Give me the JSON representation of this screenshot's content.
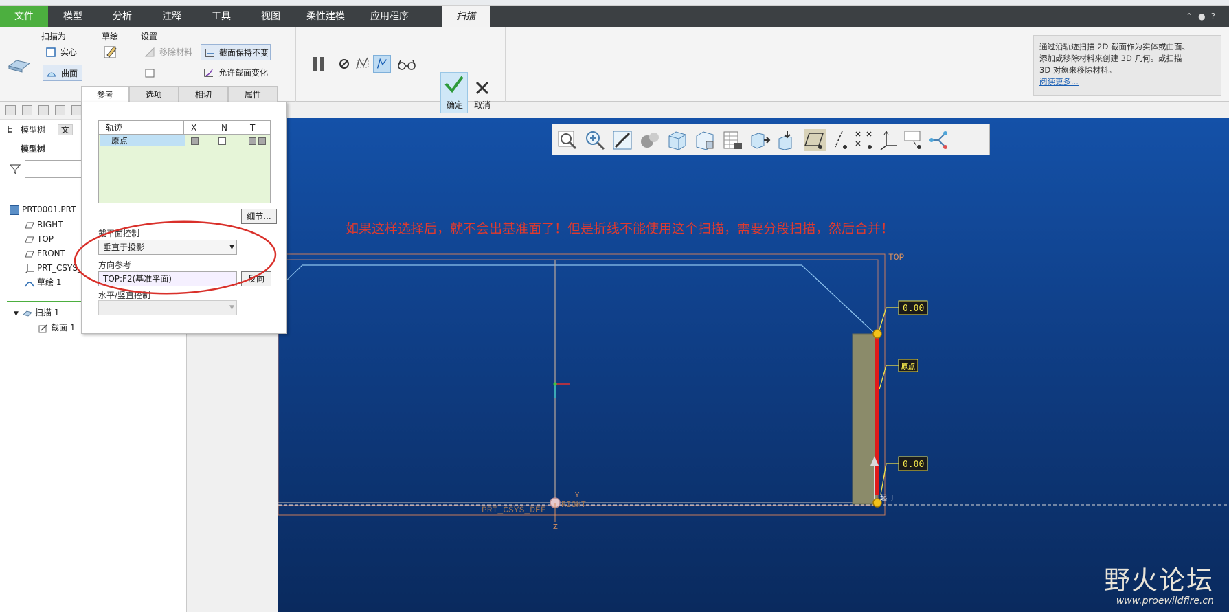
{
  "menu": {
    "tabs": [
      "文件",
      "模型",
      "分析",
      "注释",
      "工具",
      "视图",
      "柔性建模",
      "应用程序",
      "扫描"
    ],
    "active_tab": "扫描",
    "file_tab_color": "#4caf3f"
  },
  "ribbon": {
    "sweep_as": {
      "label": "扫描为",
      "solid": "实心",
      "surface": "曲面"
    },
    "sketch": {
      "label": "草绘"
    },
    "settings": {
      "label": "设置",
      "remove_material": "移除材料",
      "constant_section": "截面保持不变",
      "allow_section_change": "允许截面变化"
    },
    "ok": "确定",
    "cancel": "取消",
    "help": {
      "line1": "通过沿轨迹扫描 2D 截面作为实体或曲面、",
      "line2": "添加或移除材料来创建 3D 几何。或扫描",
      "line3": "3D 对象来移除材料。",
      "link": "阅读更多..."
    }
  },
  "dashboard_tabs": [
    "参考",
    "选项",
    "相切",
    "属性"
  ],
  "references": {
    "table_headers": [
      "轨迹",
      "X",
      "N",
      "T"
    ],
    "trajectory_name": "原点",
    "details_button": "细节...",
    "section_plane_label": "截平面控制",
    "section_plane_value": "垂直于投影",
    "direction_label": "方向参考",
    "direction_value": "TOP:F2(基准平面)",
    "flip_button": "反向",
    "hv_label": "水平/竖直控制"
  },
  "model_tree": {
    "tab_label": "模型树",
    "tab2_label": "文",
    "header": "模型树",
    "items": [
      "PRT0001.PRT",
      "RIGHT",
      "TOP",
      "FRONT",
      "PRT_CSYS_DEF",
      "草绘 1",
      "扫描 1",
      "截面 1"
    ]
  },
  "viewport": {
    "annotation": "如果这样选择后，就不会出基准面了！但是折线不能使用这个扫描，需要分段扫描，然后合并！",
    "labels": {
      "top_plane": "TOP",
      "dim_top": "0.00",
      "dim_bottom": "0.00",
      "origin_tag": "原点",
      "csys": "PRT_CSYS_DEF",
      "right": "RIGHT",
      "y_axis": "Y",
      "z_axis": "Z",
      "start_mark": "起",
      "j_mark": "J"
    },
    "watermark_logo": "野火论坛",
    "watermark_url": "www.proewildfire.cn",
    "annotation_color": "#e03a2e",
    "bg_top": "#1451a8",
    "bg_bottom": "#0a2a5e"
  }
}
